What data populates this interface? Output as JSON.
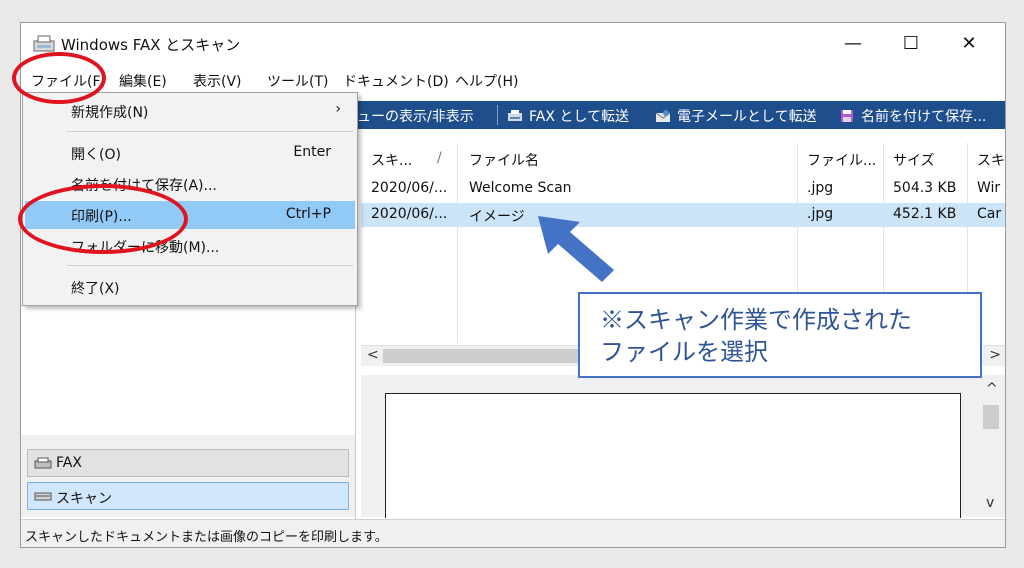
{
  "window": {
    "title": "Windows FAX とスキャン",
    "min": "—",
    "max": "☐",
    "close": "✕"
  },
  "menubar": [
    "ファイル(F)",
    "編集(E)",
    "表示(V)",
    "ツール(T)",
    "ドキュメント(D)",
    "ヘルプ(H)"
  ],
  "toolbar": {
    "pane_toggle": "ューの表示/非表示",
    "fax_forward": "FAX として転送",
    "email_forward": "電子メールとして転送",
    "save_as": "名前を付けて保存..."
  },
  "file_menu": [
    {
      "label": "新規作成(N)",
      "shortcut": "",
      "submenu": "›"
    },
    {
      "label": "開く(O)",
      "shortcut": "Enter"
    },
    {
      "label": "名前を付けて保存(A)...",
      "shortcut": ""
    },
    {
      "label": "印刷(P)...",
      "shortcut": "Ctrl+P"
    },
    {
      "label": "フォルダーに移動(M)...",
      "shortcut": ""
    },
    {
      "label": "終了(X)",
      "shortcut": ""
    }
  ],
  "list": {
    "columns": [
      "スキ...",
      "ファイル名",
      "ファイル...",
      "サイズ",
      "スキ"
    ],
    "sort_indicator": "/",
    "rows": [
      [
        "2020/06/...",
        "Welcome Scan",
        ".jpg",
        "504.3 KB",
        "Wir"
      ],
      [
        "2020/06/...",
        "イメージ",
        ".jpg",
        "452.1 KB",
        "Car"
      ]
    ],
    "selected_row": 1
  },
  "folders": {
    "fax": "FAX",
    "scan": "スキャン"
  },
  "scroll": {
    "left": "<",
    "right": ">",
    "up": "^",
    "down": "v"
  },
  "status": "スキャンしたドキュメントまたは画像のコピーを印刷します。",
  "callout": {
    "line1": "※スキャン作業で作成された",
    "line2": "ファイルを選択"
  },
  "colors": {
    "toolbar": "#1f4e8c",
    "highlight": "#91c9f7",
    "selected_row": "#cce4f7",
    "annotation_red": "#e0141f",
    "callout_blue": "#4472c4"
  }
}
